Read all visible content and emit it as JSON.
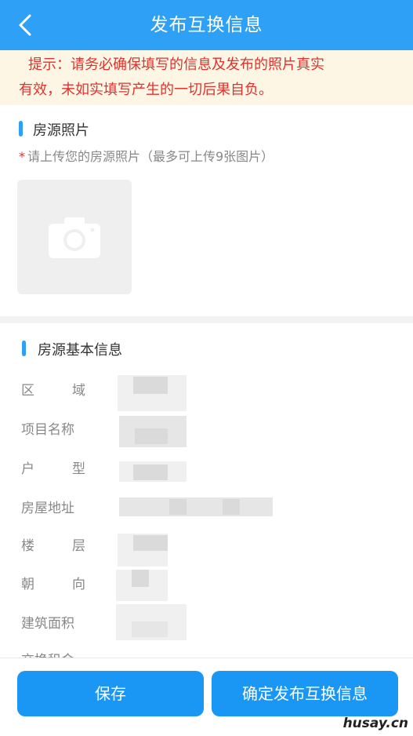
{
  "header": {
    "title": "发布互换信息",
    "back_icon": "chevron-left-icon",
    "background": "#2ea0f5"
  },
  "notice": {
    "line1": "提示：请务必确保填写的信息及发布的照片真实",
    "line2": "有效，未如实填写产生的一切后果自负。",
    "text_color": "#e0322f",
    "background": "#fdf6e4"
  },
  "photos": {
    "section_title": "房源照片",
    "required_mark": "*",
    "hint": "请上传您的房源照片（最多可上传9张图片）",
    "upload_icon": "camera-icon"
  },
  "basic_info": {
    "section_title": "房源基本信息",
    "fields": [
      {
        "label_a": "区",
        "label_b": "域"
      },
      {
        "label": "项目名称"
      },
      {
        "label_a": "户",
        "label_b": "型"
      },
      {
        "label": "房屋地址"
      },
      {
        "label_a": "楼",
        "label_b": "层"
      },
      {
        "label_a": "朝",
        "label_b": "向"
      },
      {
        "label": "建筑面积"
      },
      {
        "label": "交换租金"
      }
    ]
  },
  "footer": {
    "save_label": "保存",
    "publish_label": "确定发布互换信息",
    "accent": "#1a97f5"
  },
  "watermark": "husay.cn"
}
